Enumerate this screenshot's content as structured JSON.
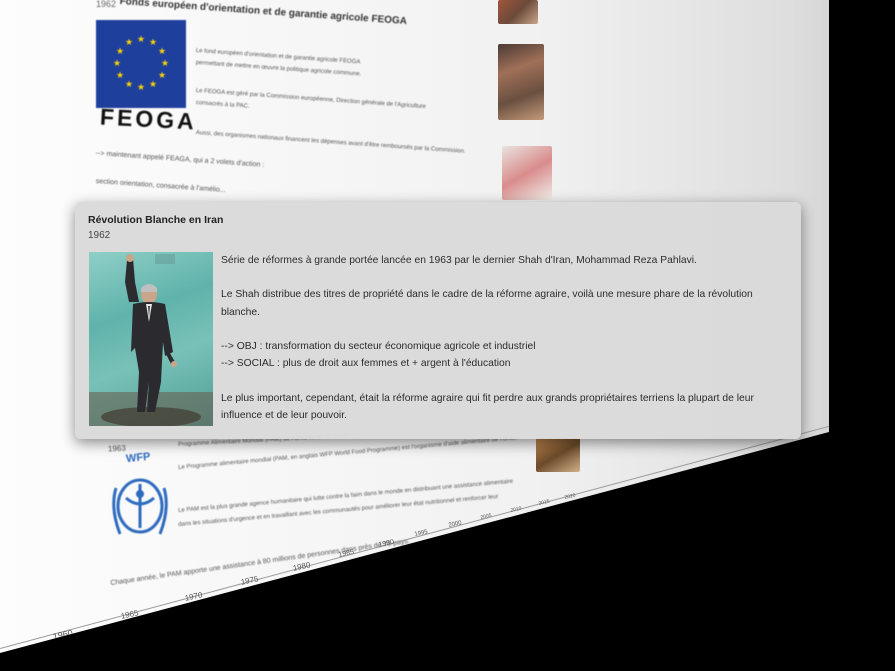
{
  "background_timeline": {
    "top_card": {
      "title": "Fonds européen d'orientation et de garantie agricole FEOGA",
      "date": "1962",
      "logo_text": "FEOGA",
      "lines": [
        "Le fond européen d'orientation et de garantie agricole FEOGA",
        "permettant de mettre en œuvre la politique agricole commune.",
        "Le FEOGA est géré par la Commission européenne, Direction générale de l'Agriculture",
        "consacrés à la PAC.",
        "Aussi, des organismes nationaux financent les dépenses avant d'être remboursés par la Commission.",
        "--> maintenant appelé FEAGA, qui a 2 volets d'action :",
        "section orientation, consacrée à l'amélio..."
      ]
    },
    "bottom_card": {
      "title": "Programme Alimentaire Mondial (PAM) de l'ONU",
      "date": "1963",
      "logo_text": "WFP",
      "lines": [
        "Programme Alimentaire Mondial (PAM) de l'ONU fondé en 1963",
        "Le Programme alimentaire mondial (PAM, en anglais WFP World Food Programme) est l'organisme d'aide alimentaire de l'ONU.",
        "Le PAM est la plus grande agence humanitaire qui lutte contre la faim dans le monde en distribuant une assistance alimentaire",
        "dans les situations d'urgence et en travaillant avec les communautés pour améliorer leur état nutritionnel et renforcer leur",
        "Chaque année, le PAM apporte une assistance à 80 millions de personnes dans près de 75 pays."
      ]
    },
    "axis_years": [
      "1960",
      "1965",
      "1970",
      "1975",
      "1980",
      "1985",
      "1990",
      "1995",
      "2000",
      "2005",
      "2010",
      "2015",
      "2020"
    ]
  },
  "popup": {
    "title": "Révolution Blanche en Iran",
    "date": "1962",
    "paragraphs": [
      "Série de réformes à grande portée lancée en 1963 par le dernier Shah d'Iran, Mohammad Reza Pahlavi.",
      "Le Shah distribue des titres de propriété dans le cadre de la réforme agraire, voilà une mesure phare de la révolution blanche.",
      "--> OBJ : transformation du secteur économique agricole et industriel",
      "--> SOCIAL : plus de droit aux femmes et + argent à l'éducation",
      "Le plus important, cependant, était la réforme agraire qui fit perdre aux grands propriétaires terriens la plupart de leur influence et de leur pouvoir."
    ]
  },
  "colors": {
    "eu_blue": "#1e3f9c",
    "eu_star": "#ffd400",
    "wfp_blue": "#2d6bbf",
    "popup_bg": "#dadada"
  }
}
